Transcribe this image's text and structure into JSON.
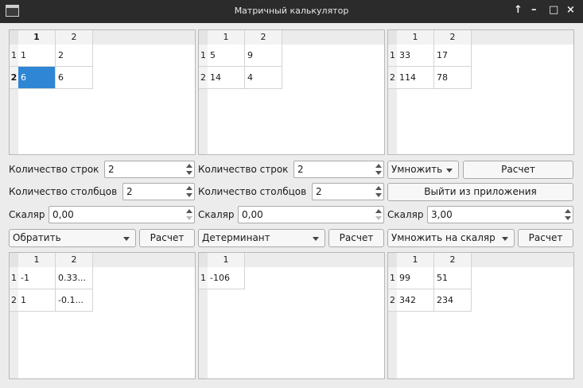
{
  "window": {
    "title": "Матричный калькулятор"
  },
  "title_controls": {
    "up": "↑",
    "minimize": "–",
    "maximize": "□",
    "close": "×"
  },
  "matrixA": {
    "col_headers": [
      "1",
      "2"
    ],
    "row_headers": [
      "1",
      "2"
    ],
    "cells": [
      [
        "1",
        "2"
      ],
      [
        "6",
        "6"
      ]
    ]
  },
  "matrixB": {
    "col_headers": [
      "1",
      "2"
    ],
    "row_headers": [
      "1",
      "2"
    ],
    "cells": [
      [
        "5",
        "9"
      ],
      [
        "14",
        "4"
      ]
    ]
  },
  "matrixC": {
    "col_headers": [
      "1",
      "2"
    ],
    "row_headers": [
      "1",
      "2"
    ],
    "cells": [
      [
        "33",
        "17"
      ],
      [
        "114",
        "78"
      ]
    ]
  },
  "controls": {
    "rows_label": "Количество строк",
    "cols_label": "Количество столбцов",
    "scalar_label": "Скаляр",
    "a_rows": "2",
    "a_cols": "2",
    "a_scalar": "0,00",
    "b_rows": "2",
    "b_cols": "2",
    "b_scalar": "0,00",
    "c_scalar": "3,00",
    "a_op": "Обратить",
    "b_op": "Детерминант",
    "c_op": "Умножить на скаляр",
    "binary_op": "Умножить",
    "calc": "Расчет",
    "exit": "Выйти из приложения"
  },
  "resultA": {
    "col_headers": [
      "1",
      "2"
    ],
    "row_headers": [
      "1",
      "2"
    ],
    "cells": [
      [
        "-1",
        "0.33..."
      ],
      [
        "1",
        "-0.1..."
      ]
    ]
  },
  "resultB": {
    "col_headers": [
      "1"
    ],
    "row_headers": [
      "1"
    ],
    "cells": [
      [
        "-106"
      ]
    ]
  },
  "resultC": {
    "col_headers": [
      "1",
      "2"
    ],
    "row_headers": [
      "1",
      "2"
    ],
    "cells": [
      [
        "99",
        "51"
      ],
      [
        "342",
        "234"
      ]
    ]
  }
}
